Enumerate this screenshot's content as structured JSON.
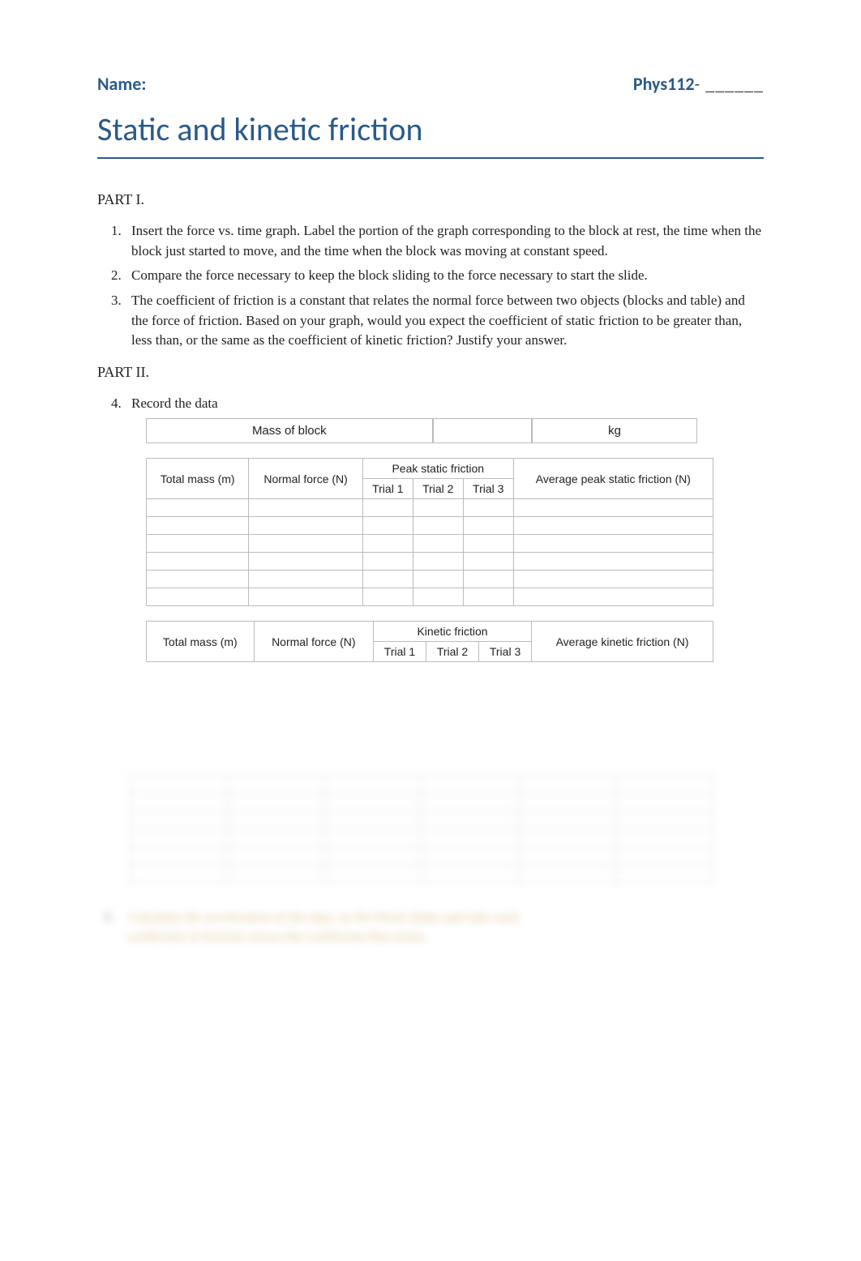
{
  "header": {
    "name_label": "Name:",
    "course_prefix": "Phys112",
    "course_dash": "- ______"
  },
  "title": "Static and kinetic friction",
  "part1": {
    "heading": "PART I.",
    "items": [
      "Insert the force vs. time graph. Label the portion of the graph corresponding to the block at rest, the time when the block just started to move, and the time when the block was moving at constant speed.",
      "Compare the force necessary to keep the block sliding to the force necessary to start the slide.",
      "The coefficient of friction is a constant that relates the normal force between two objects (blocks and table) and the force of friction. Based on your graph, would you expect the coefficient of static friction to be greater than, less than, or the same as the coefficient of kinetic friction? Justify your answer."
    ]
  },
  "part2": {
    "heading": "PART II.",
    "item4": "Record the data",
    "mass_label": "Mass of  block",
    "mass_unit": "kg",
    "table_static": {
      "col_total_mass": "Total mass (m)",
      "col_normal_force": "Normal force (N)",
      "group_header": "Peak static friction",
      "col_trial1": "Trial 1",
      "col_trial2": "Trial 2",
      "col_trial3": "Trial 3",
      "col_avg": "Average peak static friction (N)"
    },
    "table_kinetic": {
      "col_total_mass": "Total mass (m)",
      "col_normal_force": "Normal force (N)",
      "group_header": "Kinetic friction",
      "col_trial1": "Trial 1",
      "col_trial2": "Trial 2",
      "col_trial3": "Trial 3",
      "col_avg": "Average kinetic friction (N)"
    }
  },
  "blurred": {
    "item5_num": "5.",
    "item5_text_line1": "Calculate the acceleration of the data, as the block slides and take each",
    "item5_text_line2": "coefficient of friction versus the coefficient that exists."
  }
}
